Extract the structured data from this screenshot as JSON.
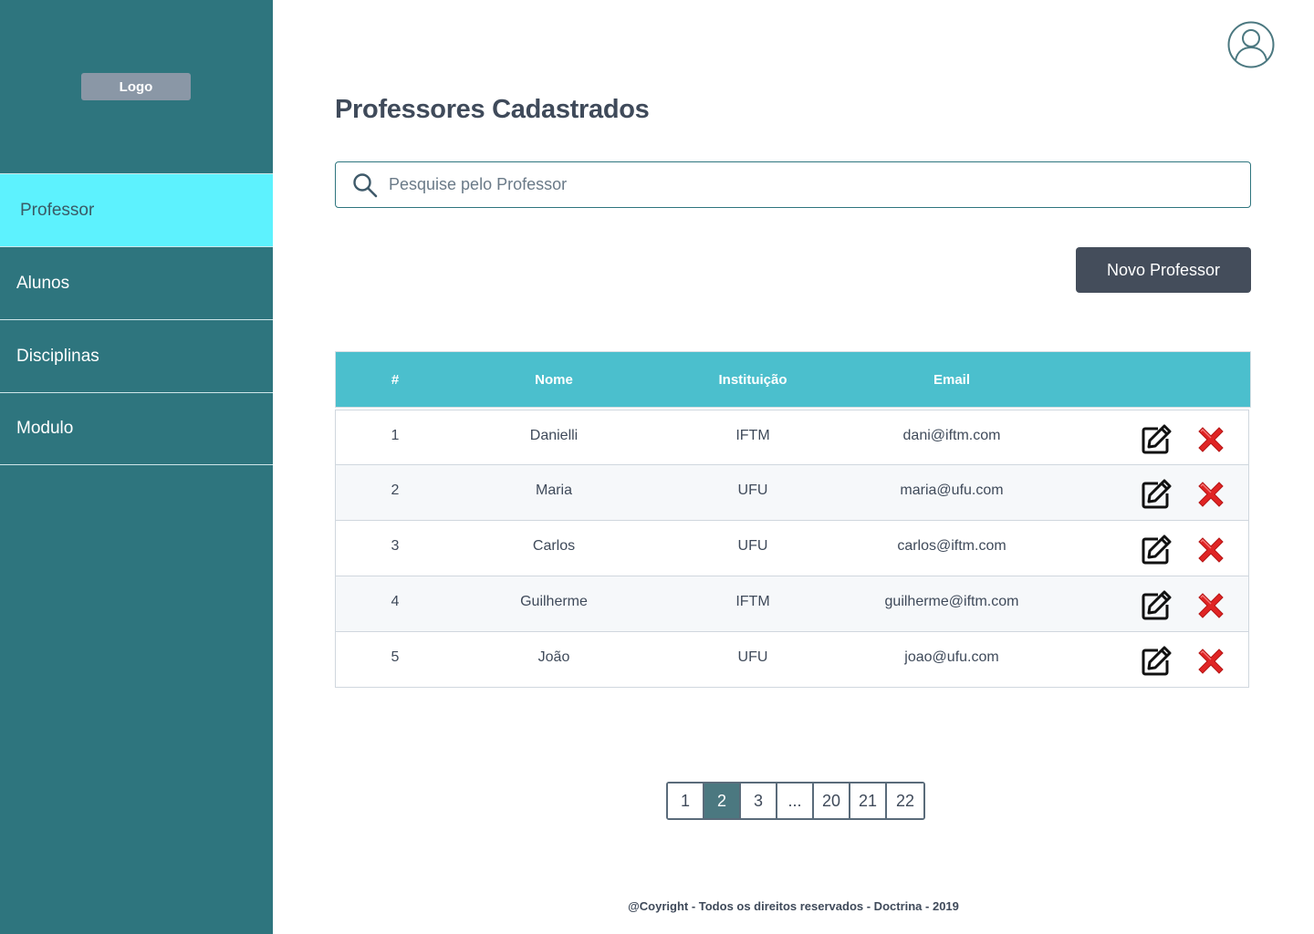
{
  "sidebar": {
    "logo": "Logo",
    "items": [
      {
        "label": "Professor",
        "active": true
      },
      {
        "label": "Alunos"
      },
      {
        "label": "Disciplinas"
      },
      {
        "label": "Modulo"
      }
    ]
  },
  "header": {
    "avatar_icon": "user-circle-icon"
  },
  "main": {
    "title": "Professores Cadastrados",
    "search": {
      "placeholder": "Pesquise pelo Professor",
      "value": ""
    },
    "new_button": "Novo Professor"
  },
  "table": {
    "columns": [
      "#",
      "Nome",
      "Instituição",
      "Email"
    ],
    "rows": [
      {
        "id": "1",
        "nome": "Danielli",
        "instituicao": "IFTM",
        "email": "dani@iftm.com"
      },
      {
        "id": "2",
        "nome": "Maria",
        "instituicao": "UFU",
        "email": "maria@ufu.com"
      },
      {
        "id": "3",
        "nome": "Carlos",
        "instituicao": "UFU",
        "email": "carlos@iftm.com"
      },
      {
        "id": "4",
        "nome": "Guilherme",
        "instituicao": "IFTM",
        "email": "guilherme@iftm.com"
      },
      {
        "id": "5",
        "nome": "João",
        "instituicao": "UFU",
        "email": "joao@ufu.com"
      }
    ],
    "edit_icon": "edit-icon",
    "delete_icon": "delete-x-icon"
  },
  "pagination": {
    "pages": [
      "1",
      "2",
      "3",
      "...",
      "20",
      "21",
      "22"
    ],
    "current": "2"
  },
  "footer": "@Coyright - Todos os direitos reservados - Doctrina - 2019",
  "colors": {
    "sidebar_bg": "#2e757e",
    "active_nav": "#5df2fe",
    "table_header": "#4bbfcd",
    "button_dark": "#444d5b",
    "delete_red": "#e02424"
  }
}
